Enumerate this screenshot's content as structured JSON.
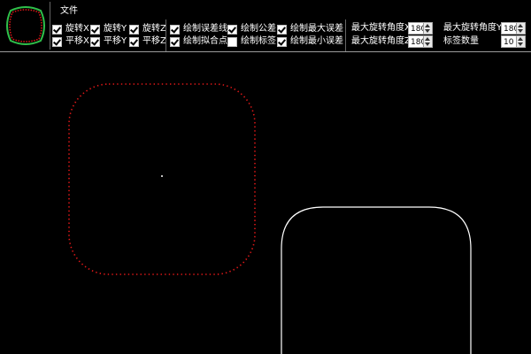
{
  "menu": {
    "file_label": "文件"
  },
  "checkboxes": {
    "rotate_x": {
      "label": "旋转X",
      "checked": true
    },
    "rotate_y": {
      "label": "旋转Y",
      "checked": true
    },
    "rotate_z": {
      "label": "旋转Z",
      "checked": true
    },
    "translate_x": {
      "label": "平移X",
      "checked": true
    },
    "translate_y": {
      "label": "平移Y",
      "checked": true
    },
    "translate_z": {
      "label": "平移Z",
      "checked": true
    },
    "draw_error_line": {
      "label": "绘制误差线",
      "checked": true
    },
    "draw_tolerance": {
      "label": "绘制公差",
      "checked": true
    },
    "draw_max_error": {
      "label": "绘制最大误差",
      "checked": true
    },
    "draw_fit_points": {
      "label": "绘制拟合点",
      "checked": true
    },
    "draw_labels": {
      "label": "绘制标签",
      "checked": false
    },
    "draw_min_error": {
      "label": "绘制最小误差",
      "checked": true
    }
  },
  "settings": {
    "max_rot_x": {
      "label": "最大旋转角度X",
      "value": "180"
    },
    "max_rot_y": {
      "label": "最大旋转角度Y",
      "value": "180"
    },
    "max_rot_z": {
      "label": "最大旋转角度Z",
      "value": "180"
    },
    "label_count": {
      "label": "标签数量",
      "value": "10"
    }
  },
  "colors": {
    "dotted_shape": "#e01818",
    "outline_shape": "#ffffff",
    "logo_green": "#2fbf4a",
    "logo_red": "#e01818",
    "background": "#000000"
  }
}
